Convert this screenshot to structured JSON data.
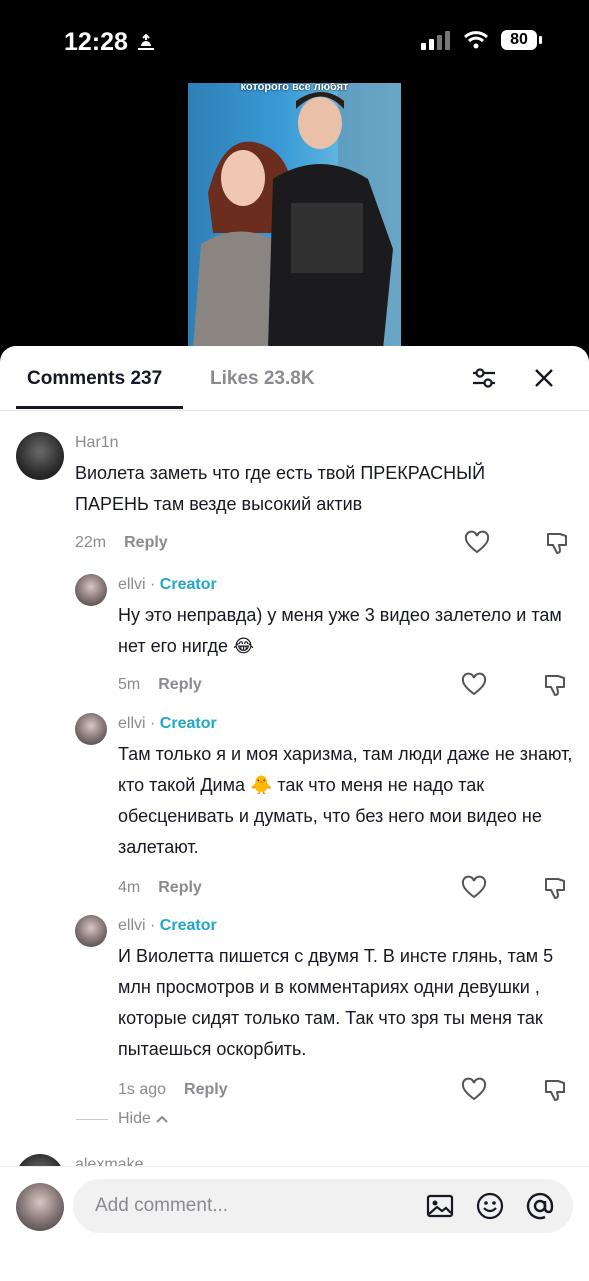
{
  "status_bar": {
    "time": "12:28",
    "battery": "80"
  },
  "video": {
    "caption": "которого все любят"
  },
  "tabs": {
    "comments": "Comments 237",
    "likes": "Likes 23.8K"
  },
  "comments": [
    {
      "username": "Har1n",
      "is_creator": false,
      "text": "Виолета заметь что где есть твой ПРЕКРАСНЫЙ ПАРЕНЬ там везде высокий актив",
      "time": "22m",
      "reply": "Reply"
    },
    {
      "username": "ellvi",
      "separator": " · ",
      "creator_label": "Creator",
      "is_creator": true,
      "text": "Ну это неправда) у меня уже 3 видео залетело и там нет его нигде 😂",
      "time": "5m",
      "reply": "Reply"
    },
    {
      "username": "ellvi",
      "separator": " · ",
      "creator_label": "Creator",
      "is_creator": true,
      "text": "Там только я и моя харизма, там люди даже не знают, кто такой Дима 🐥 так что меня не надо так обесценивать и думать, что без него мои видео не залетают.",
      "time": "4m",
      "reply": "Reply"
    },
    {
      "username": "ellvi",
      "separator": " · ",
      "creator_label": "Creator",
      "is_creator": true,
      "text": "И Виолетта пишется с двумя Т. В инсте глянь, там 5 млн просмотров и в комментариях одни девушки , которые сидят только там. Так что зря ты меня так пытаешься оскорбить.",
      "time": "1s ago",
      "reply": "Reply"
    }
  ],
  "hide_label": "Hide",
  "next_comment": {
    "username": "alexmake"
  },
  "composer": {
    "placeholder": "Add comment..."
  }
}
